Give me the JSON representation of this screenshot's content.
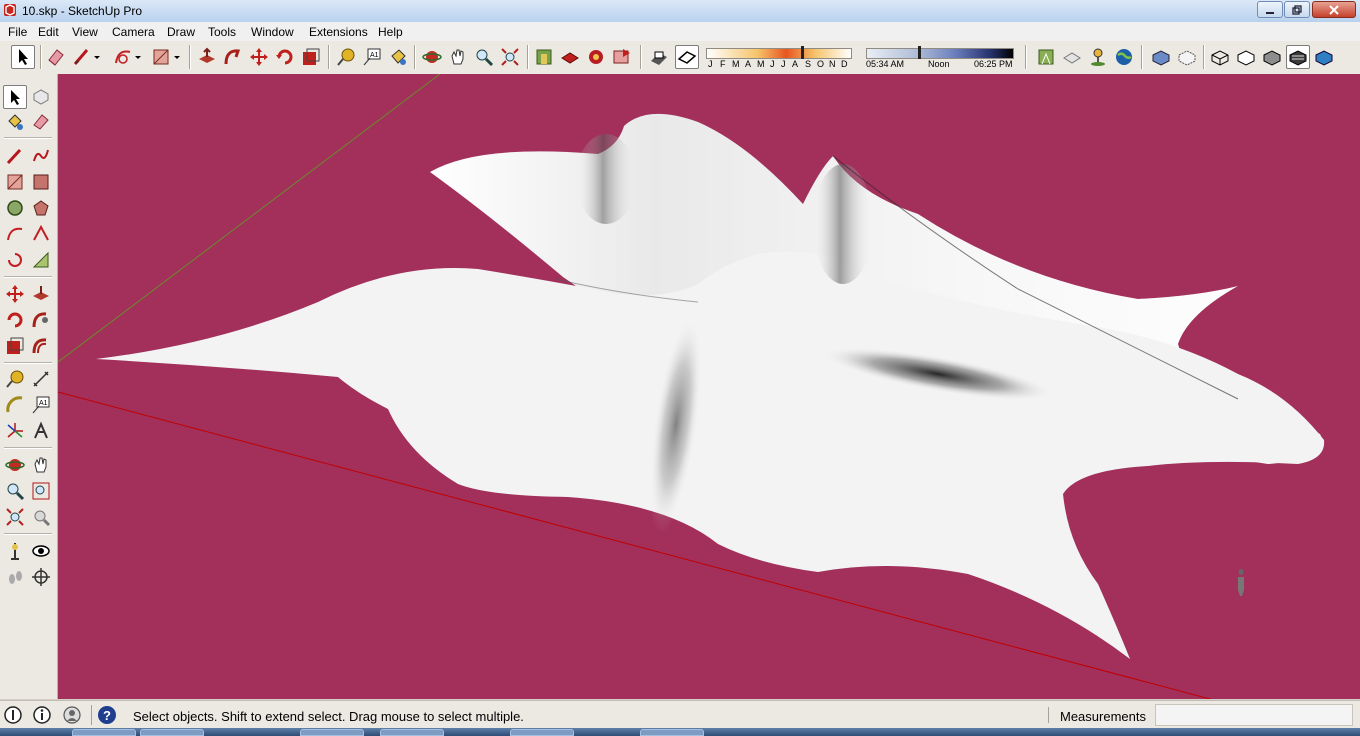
{
  "window": {
    "title": "10.skp - SketchUp Pro"
  },
  "menu": {
    "items": [
      "File",
      "Edit",
      "View",
      "Camera",
      "Draw",
      "Tools",
      "Window",
      "Extensions",
      "Help"
    ]
  },
  "shadow_settings": {
    "months": [
      "J",
      "F",
      "M",
      "A",
      "M",
      "J",
      "J",
      "A",
      "S",
      "O",
      "N",
      "D"
    ],
    "time_start": "05:34 AM",
    "time_mid": "Noon",
    "time_end": "06:25 PM"
  },
  "status": {
    "message": "Select objects. Shift to extend select. Drag mouse to select multiple.",
    "measurements_label": "Measurements",
    "measurements_value": ""
  },
  "colors": {
    "viewport_background": "#a2305b",
    "surface": "#f3f3f3",
    "red_axis": "#c00000",
    "green_axis": "#6b8a2a"
  },
  "icons": {
    "toolbar": [
      "select-icon",
      "eraser-icon",
      "pencil-icon",
      "arc-icon",
      "rectangle-icon",
      "push-pull-icon",
      "follow-me-icon",
      "move-icon",
      "rotate-icon",
      "scale-icon",
      "tape-measure-icon",
      "text-icon",
      "paint-bucket-icon",
      "orbit-icon",
      "pan-icon",
      "zoom-icon",
      "zoom-extents-icon",
      "warehouse-icon",
      "components-icon",
      "extension-icon",
      "share-icon",
      "shadows-icon",
      "fog-icon",
      "location-icon",
      "model-info-icon",
      "add-location-icon",
      "earth-icon",
      "xray-icon",
      "back-edges-icon",
      "wireframe-icon",
      "hidden-line-icon",
      "shaded-icon",
      "shaded-textures-icon",
      "monochrome-icon"
    ],
    "left_toolbar": [
      "select-icon",
      "component-icon",
      "paint-bucket-icon",
      "eraser-icon",
      "line-icon",
      "freehand-icon",
      "rectangle-icon",
      "rotated-rectangle-icon",
      "circle-icon",
      "polygon-icon",
      "arc-icon",
      "two-point-arc-icon",
      "pie-icon",
      "three-point-arc-icon",
      "move-icon",
      "push-pull-icon",
      "rotate-icon",
      "follow-me-icon",
      "scale-icon",
      "offset-icon",
      "tape-measure-icon",
      "dimension-icon",
      "protractor-icon",
      "text-icon",
      "axes-icon",
      "3d-text-icon",
      "orbit-icon",
      "pan-icon",
      "zoom-icon",
      "zoom-window-icon",
      "zoom-extents-icon",
      "previous-view-icon",
      "position-camera-icon",
      "look-around-icon",
      "walk-icon",
      "section-plane-icon"
    ]
  }
}
